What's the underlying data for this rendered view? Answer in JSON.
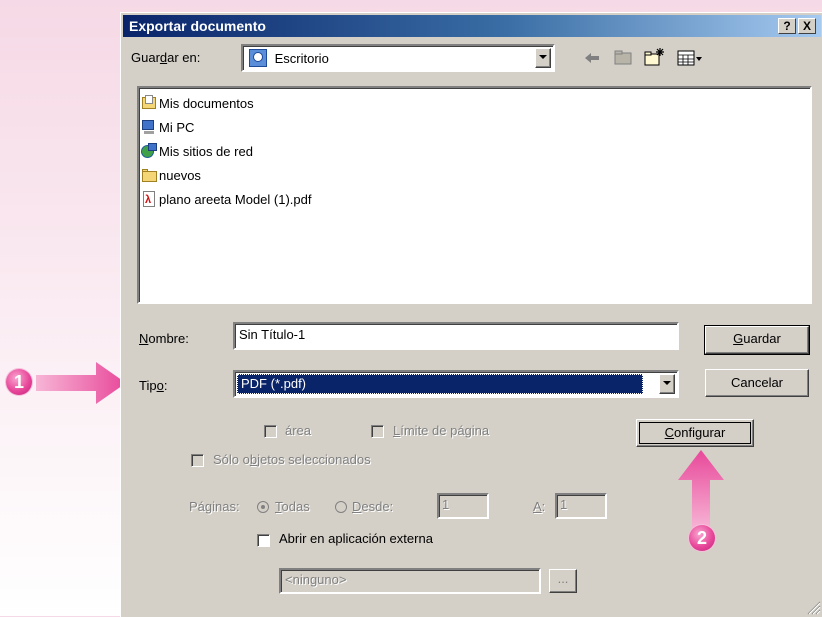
{
  "window": {
    "title": "Exportar documento",
    "help_label": "?",
    "close_label": "X"
  },
  "save_in": {
    "label_pre": "Guar",
    "label_ul": "d",
    "label_post": "ar en:",
    "location": "Escritorio"
  },
  "files": [
    {
      "name": "Mis documentos",
      "icon": "my-documents-icon"
    },
    {
      "name": "Mi PC",
      "icon": "my-computer-icon"
    },
    {
      "name": "Mis sitios de red",
      "icon": "network-places-icon"
    },
    {
      "name": "nuevos",
      "icon": "folder-icon"
    },
    {
      "name": "plano areeta Model (1).pdf",
      "icon": "pdf-file-icon"
    }
  ],
  "name_field": {
    "label_ul": "N",
    "label_post": "ombre:",
    "value": "Sin Título-1"
  },
  "type_field": {
    "label_pre": "Tip",
    "label_ul": "o",
    "label_post": ":",
    "value": "PDF (*.pdf)"
  },
  "buttons": {
    "save_ul": "G",
    "save_post": "uardar",
    "cancel": "Cancelar",
    "configure_ul": "C",
    "configure_post": "onfigurar",
    "browse": "..."
  },
  "options": {
    "area": "área",
    "page_limit_ul": "L",
    "page_limit_post": "ímite de página",
    "selected_only_pre": "Sólo o",
    "selected_only_ul": "b",
    "selected_only_post": "jetos seleccionados",
    "pages_label": "Páginas:",
    "all_ul": "T",
    "all_post": "odas",
    "from_ul": "D",
    "from_post": "esde:",
    "from_value": "1",
    "to_ul": "A",
    "to_post": ":",
    "to_value": "1",
    "open_external": "Abrir en aplicación externa",
    "app_value": "<ninguno>"
  },
  "annotations": {
    "step1": "1",
    "step2": "2"
  },
  "colors": {
    "accent": "#e8489a",
    "title_bar": "#0a246a",
    "selection": "#0a246a"
  }
}
